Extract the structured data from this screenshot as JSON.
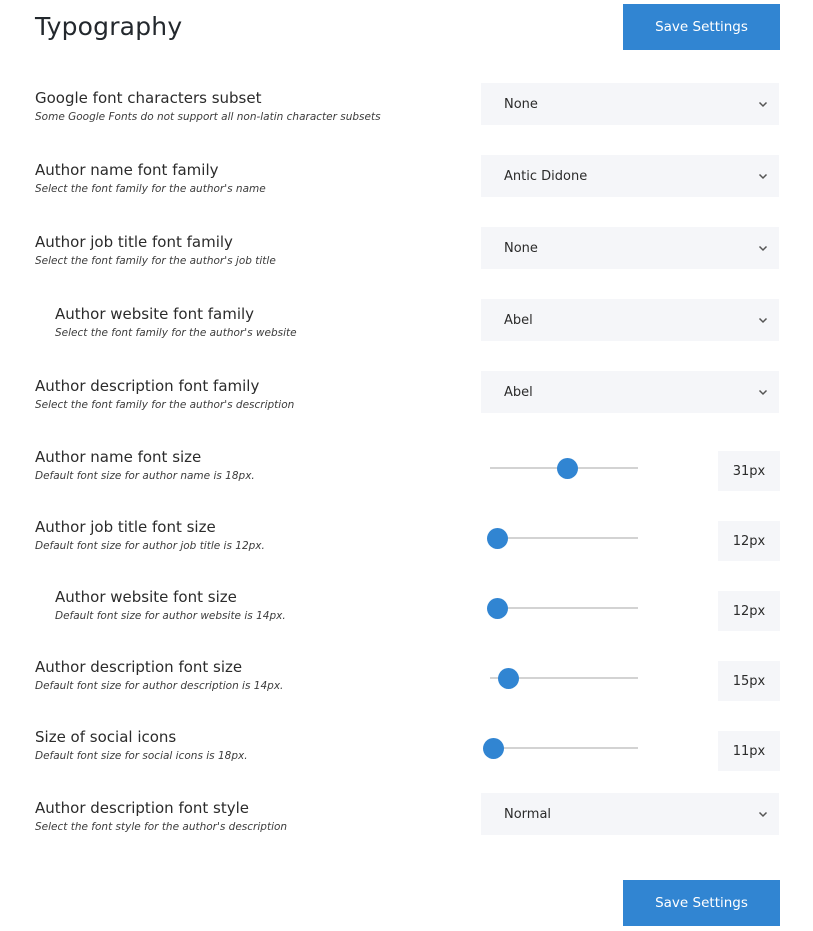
{
  "header": {
    "title": "Typography",
    "save_label": "Save Settings"
  },
  "footer": {
    "save_label": "Save Settings"
  },
  "colors": {
    "accent": "#3185d2",
    "field_bg": "#f5f6f9",
    "track": "#d3d3d3"
  },
  "settings": {
    "subset": {
      "label": "Google font characters subset",
      "hint": "Some Google Fonts do not support all non-latin character subsets",
      "value": "None"
    },
    "name_family": {
      "label": "Author name font family",
      "hint": "Select the font family for the author's name",
      "value": "Antic Didone"
    },
    "job_family": {
      "label": "Author job title font family",
      "hint": "Select the font family for the author's job title",
      "value": "None"
    },
    "website_family": {
      "label": "Author website font family",
      "hint": "Select the font family for the author's website",
      "value": "Abel"
    },
    "description_family": {
      "label": "Author description font family",
      "hint": "Select the font family for the author's description",
      "value": "Abel"
    },
    "name_size": {
      "label": "Author name font size",
      "hint": "Default font size for author name is 18px.",
      "value": 31,
      "display": "31px"
    },
    "job_size": {
      "label": "Author job title font size",
      "hint": "Default font size for author job title is 12px.",
      "value": 12,
      "display": "12px"
    },
    "website_size": {
      "label": "Author website font size",
      "hint": "Default font size for author website is 14px.",
      "value": 12,
      "display": "12px"
    },
    "description_size": {
      "label": "Author description font size",
      "hint": "Default font size for author description is 14px.",
      "value": 15,
      "display": "15px"
    },
    "social_size": {
      "label": "Size of social icons",
      "hint": "Default font size for social icons is 18px.",
      "value": 11,
      "display": "11px"
    },
    "description_style": {
      "label": "Author description font style",
      "hint": "Select the font style for the author's description",
      "value": "Normal"
    }
  },
  "slider_range": {
    "min": 10,
    "max": 50
  }
}
